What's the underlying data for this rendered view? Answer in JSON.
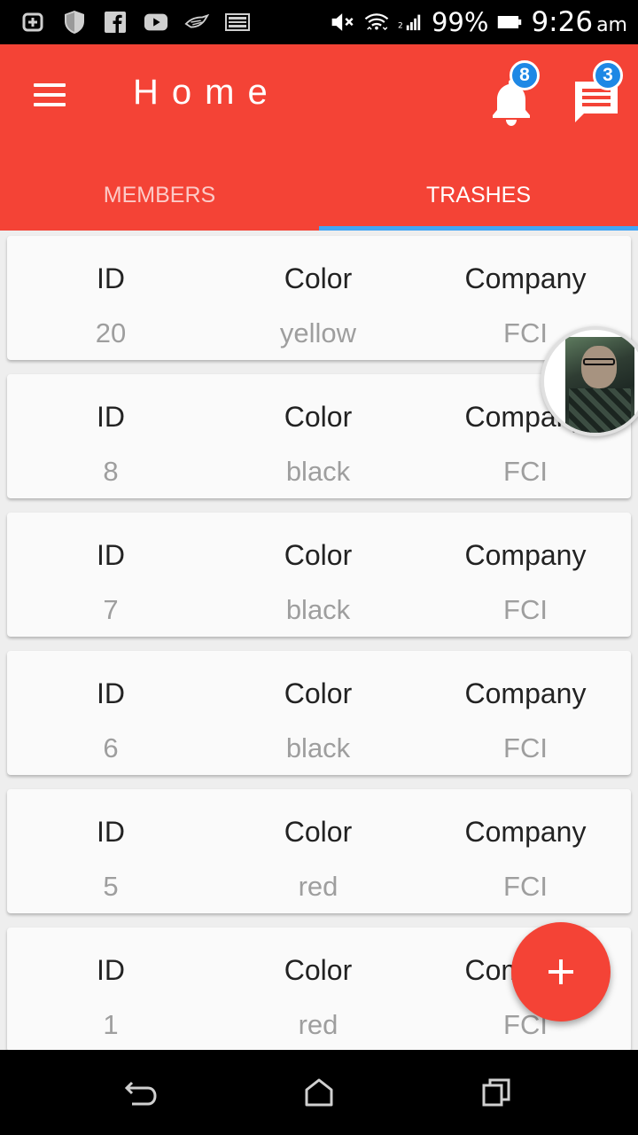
{
  "status_bar": {
    "icons_left": [
      "add-box-icon",
      "shield-icon",
      "facebook-icon",
      "youtube-icon",
      "bird-icon",
      "image-icon"
    ],
    "icons_right": [
      "mute-icon",
      "wifi-icon",
      "signal-icon"
    ],
    "battery_percent": "99%",
    "time": "9:26",
    "ampm": "am"
  },
  "app_bar": {
    "title": "Home",
    "notifications_badge": "8",
    "messages_badge": "3",
    "accent_color": "#f44336",
    "tab_indicator_color": "#42a5f5"
  },
  "tabs": [
    {
      "label": "MEMBERS",
      "active": false
    },
    {
      "label": "TRASHES",
      "active": true
    }
  ],
  "list": {
    "headers": [
      "ID",
      "Color",
      "Company"
    ],
    "rows": [
      {
        "id": "20",
        "color": "yellow",
        "company": "FCI"
      },
      {
        "id": "8",
        "color": "black",
        "company": "FCI"
      },
      {
        "id": "7",
        "color": "black",
        "company": "FCI"
      },
      {
        "id": "6",
        "color": "black",
        "company": "FCI"
      },
      {
        "id": "5",
        "color": "red",
        "company": "FCI"
      },
      {
        "id": "1",
        "color": "red",
        "company": "FCI"
      }
    ]
  },
  "fab": {
    "icon": "plus-icon"
  },
  "nav_bar": {
    "icons": [
      "back-icon",
      "home-icon",
      "recents-icon"
    ]
  }
}
